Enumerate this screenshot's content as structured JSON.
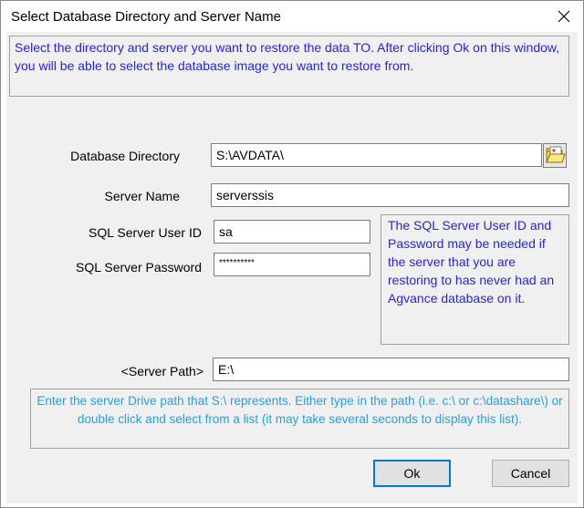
{
  "window": {
    "title": "Select Database Directory and Server Name",
    "close_icon": "close-icon"
  },
  "info_top": "Select the directory and server you want to restore the data TO.  After clicking Ok on this window, you will be able to select the database image you want to restore from.",
  "fields": {
    "database_directory": {
      "label": "Database Directory",
      "value": "S:\\AVDATA\\"
    },
    "server_name": {
      "label": "Server Name",
      "value": "serverssis"
    },
    "sql_user_id": {
      "label": "SQL Server User ID",
      "value": "sa"
    },
    "sql_password": {
      "label": "SQL Server Password",
      "value": "**********"
    },
    "server_path": {
      "label": "<Server Path>",
      "value": "E:\\"
    }
  },
  "browse_icon": "folder-open-icon",
  "note": "The SQL Server User ID and Password may be needed if the server that you are restoring to has never had an Agvance database on it.",
  "info_bottom": "Enter the server Drive path that S:\\ represents. Either type in the path (i.e. c:\\ or c:\\datashare\\) or double click and select from a list (it may take several seconds to display this list).",
  "buttons": {
    "ok": "Ok",
    "cancel": "Cancel"
  },
  "colors": {
    "info_text": "#2626d9",
    "hint_text": "#27a0e0",
    "default_button_border": "#0078d7"
  }
}
